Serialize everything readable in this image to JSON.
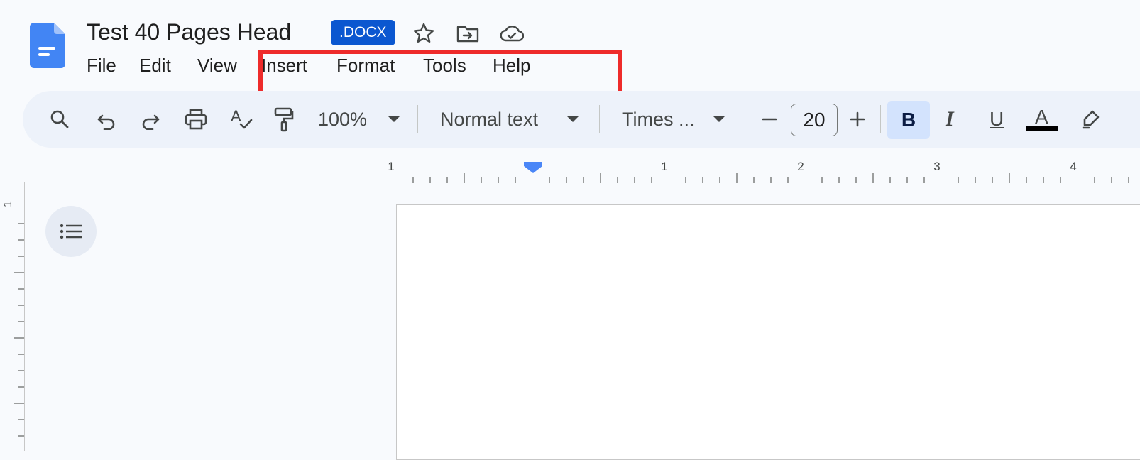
{
  "document": {
    "title": "Test 40 Pages Head",
    "badge": ".DOCX",
    "icons": [
      "docs-logo-icon",
      "star-icon",
      "move-to-folder-icon",
      "cloud-saved-icon"
    ]
  },
  "menu": {
    "file": "File",
    "edit": "Edit",
    "view": "View",
    "insert": "Insert",
    "format": "Format",
    "tools": "Tools",
    "help": "Help"
  },
  "toolbar": {
    "zoom": "100%",
    "style": "Normal text",
    "font": "Times ...",
    "font_size": "20",
    "bold": "B",
    "italic": "I",
    "underline": "U",
    "text_color": "A",
    "icons": [
      "search-icon",
      "undo-icon",
      "redo-icon",
      "print-icon",
      "spellcheck-icon",
      "paint-format-icon",
      "dropdown-arrow-icon",
      "minus-icon",
      "plus-icon",
      "highlighter-icon"
    ]
  },
  "ruler": {
    "top_labels": [
      "1",
      "1",
      "2",
      "3",
      "4"
    ],
    "left_labels": [
      "1"
    ]
  },
  "colors": {
    "brand": "#0b57d0",
    "highlight_box": "#ee2b2b",
    "toolbar_bg": "#edf2fa",
    "bold_active": "#d3e3fd"
  }
}
